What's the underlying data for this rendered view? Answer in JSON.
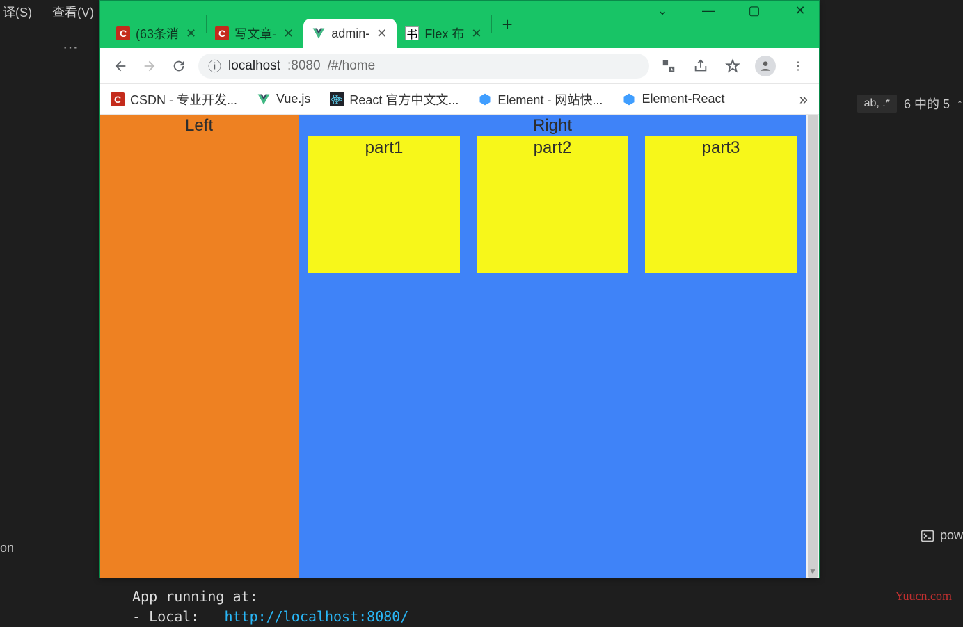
{
  "bg": {
    "menu1": "译(S)",
    "menu2": "查看(V)",
    "right_tab": "ab, .*",
    "right_count": "6 中的 5",
    "on": "on",
    "pow": "pow"
  },
  "terminal": {
    "line1": "App running at:",
    "line2_prefix": "- Local:   ",
    "line2_url": "http://localhost:8080/"
  },
  "watermark": "Yuucn.com",
  "browser": {
    "tabs": [
      {
        "label": "(63条消",
        "kind": "csdn"
      },
      {
        "label": "写文章-",
        "kind": "csdn"
      },
      {
        "label": "admin-",
        "kind": "vue",
        "active": true
      },
      {
        "label": "Flex 布",
        "kind": "book"
      }
    ],
    "url": {
      "host": "localhost",
      "port": ":8080",
      "path": "/#/home"
    },
    "bookmarks": [
      {
        "label": "CSDN - 专业开发...",
        "kind": "csdn"
      },
      {
        "label": "Vue.js",
        "kind": "vue"
      },
      {
        "label": "React 官方中文文...",
        "kind": "react"
      },
      {
        "label": "Element - 网站快...",
        "kind": "element"
      },
      {
        "label": "Element-React",
        "kind": "element"
      }
    ]
  },
  "page": {
    "left": "Left",
    "right": "Right",
    "parts": [
      "part1",
      "part2",
      "part3"
    ]
  }
}
